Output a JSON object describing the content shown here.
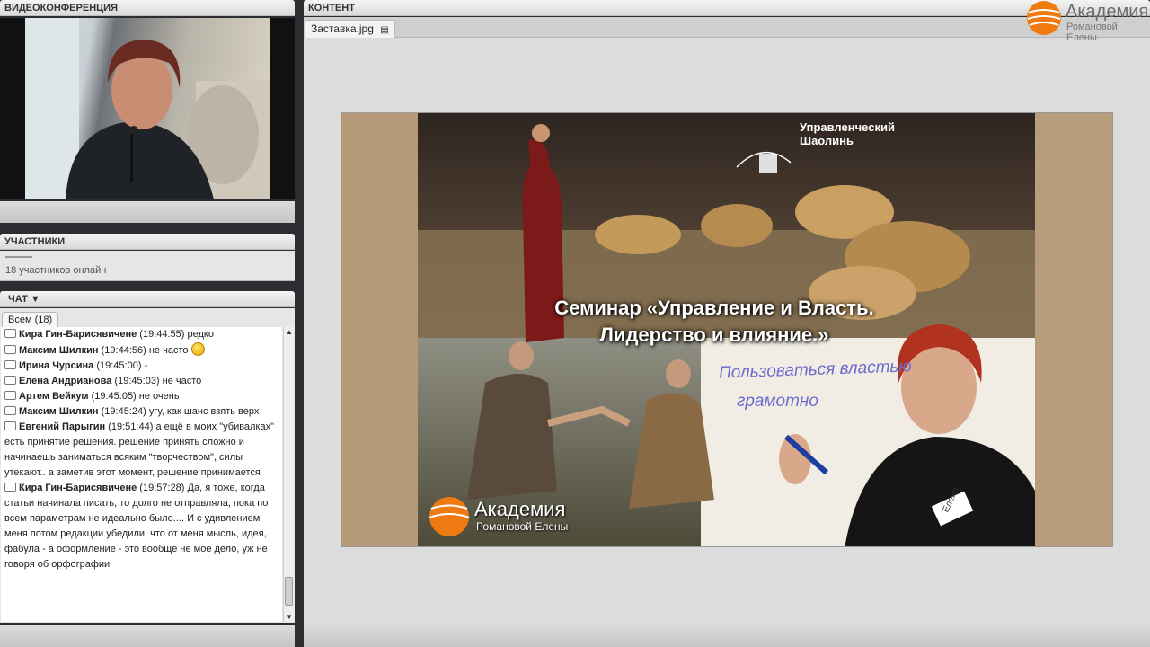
{
  "video_panel": {
    "title": "ВИДЕОКОНФЕРЕНЦИЯ"
  },
  "participants_panel": {
    "title": "УЧАСТНИКИ",
    "count_text": "18 участников онлайн"
  },
  "chat_panel": {
    "title": "ЧАТ ▼",
    "tab_label": "Всем (18)",
    "messages": [
      {
        "author": "Кира Гин-Барисявичене",
        "time": "(19:44:55)",
        "text": "редко"
      },
      {
        "author": "Максим Шилкин",
        "time": "(19:44:56)",
        "text": "не часто"
      },
      {
        "author": "Ирина Чурсина",
        "time": "(19:45:00)",
        "text": "-"
      },
      {
        "author": "Елена Андрианова",
        "time": "(19:45:03)",
        "text": "не часто"
      },
      {
        "author": "Артем Вейкум",
        "time": "(19:45:05)",
        "text": "не очень"
      },
      {
        "author": "Максим Шилкин",
        "time": "(19:45:24)",
        "text": "угу, как шанс взять верх"
      },
      {
        "author": "Евгений Парыгин",
        "time": "(19:51:44)",
        "text": "а ещё в моих \"убивалках\" есть принятие решения. решение принять сложно и начинаешь заниматься всяким \"творчеством\", силы утекают.. а заметив этот момент, решение принимается"
      },
      {
        "author": "Кира Гин-Барисявичене",
        "time": "(19:57:28)",
        "text": "Да, я тоже, когда статьи начинала писать, то долго не отправляла, пока по всем параметрам не идеально было.... И с удивлением меня потом редакции убедили, что от меня мысль, идея, фабула - а оформление - это вообще не мое дело, уж не говоря об орфографии"
      }
    ]
  },
  "content_panel": {
    "title": "КОНТЕНТ",
    "file_tab": "Заставка.jpg",
    "brand_name": "Академия",
    "brand_sub": "Романовой Елены"
  },
  "slide": {
    "title_line1": "Семинар «Управление и Власть.",
    "title_line2": "Лидерство и влияние.»",
    "logo_top": "Управленческий",
    "logo_bottom": "Шаолинь",
    "board_line1": "Пользоваться властью",
    "board_line2": "грамотно",
    "badge": "Елена",
    "brand_name": "Академия",
    "brand_sub": "Романовой Елены"
  },
  "colors": {
    "accent_orange": "#f07a12",
    "panel_bg": "#e6e6e6",
    "frame_bg": "#2b2d31"
  }
}
